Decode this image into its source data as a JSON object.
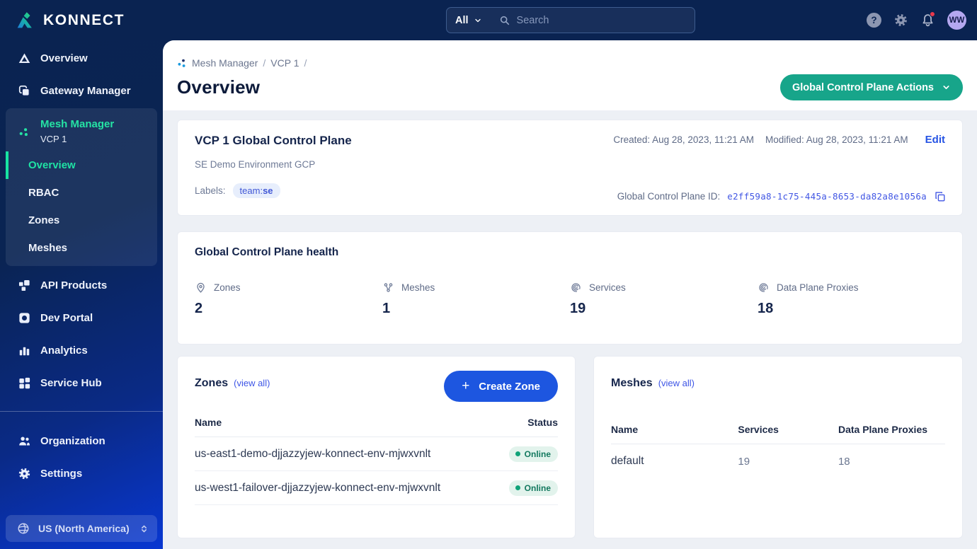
{
  "topbar": {
    "brand": "KONNECT",
    "search_scope": "All",
    "search_placeholder": "Search",
    "help_glyph": "?",
    "avatar_initials": "WW"
  },
  "sidebar": {
    "top_items": [
      {
        "label": "Overview"
      },
      {
        "label": "Gateway Manager"
      }
    ],
    "mesh_panel": {
      "title": "Mesh Manager",
      "subtitle": "VCP 1",
      "sub_items": [
        {
          "label": "Overview",
          "active": true
        },
        {
          "label": "RBAC",
          "active": false
        },
        {
          "label": "Zones",
          "active": false
        },
        {
          "label": "Meshes",
          "active": false
        }
      ]
    },
    "mid_items": [
      {
        "label": "API Products"
      },
      {
        "label": "Dev Portal"
      },
      {
        "label": "Analytics"
      },
      {
        "label": "Service Hub"
      }
    ],
    "bottom_items": [
      {
        "label": "Organization"
      },
      {
        "label": "Settings"
      }
    ],
    "region_selector": "US (North America)"
  },
  "page": {
    "breadcrumb": {
      "product": "Mesh Manager",
      "control_plane": "VCP 1",
      "sep": "/"
    },
    "title": "Overview",
    "actions_button": "Global Control Plane Actions"
  },
  "info_card": {
    "title": "VCP 1 Global Control Plane",
    "description": "SE Demo Environment GCP",
    "labels_label": "Labels:",
    "label_key": "team:",
    "label_value": "se",
    "created": "Created: Aug 28, 2023, 11:21 AM",
    "modified": "Modified: Aug 28, 2023, 11:21 AM",
    "edit_label": "Edit",
    "id_label": "Global Control Plane ID:",
    "id_value": "e2ff59a8-1c75-445a-8653-da82a8e1056a"
  },
  "health_card": {
    "title": "Global Control Plane health",
    "metrics": [
      {
        "label": "Zones",
        "value": "2",
        "icon": "pin-icon"
      },
      {
        "label": "Meshes",
        "value": "1",
        "icon": "mesh-network-icon"
      },
      {
        "label": "Services",
        "value": "19",
        "icon": "service-spiral-icon"
      },
      {
        "label": "Data Plane Proxies",
        "value": "18",
        "icon": "service-spiral-icon"
      }
    ]
  },
  "zones_card": {
    "title": "Zones",
    "view_all": "(view all)",
    "create_button": "Create Zone",
    "plus_glyph": "+",
    "columns": [
      "Name",
      "Status"
    ],
    "rows": [
      {
        "name": "us-east1-demo-djjazzyjew-konnect-env-mjwxvnlt",
        "status": "Online"
      },
      {
        "name": "us-west1-failover-djjazzyjew-konnect-env-mjwxvnlt",
        "status": "Online"
      }
    ]
  },
  "meshes_card": {
    "title": "Meshes",
    "view_all": "(view all)",
    "columns": [
      "Name",
      "Services",
      "Data Plane Proxies"
    ],
    "rows": [
      {
        "name": "default",
        "services": "19",
        "proxies": "18"
      }
    ]
  },
  "colors": {
    "topbar_navy": "#0a2351",
    "sidebar_blue_bottom": "#0837d2",
    "accent_teal_button": "#17a58a",
    "accent_blue_button": "#1d56e0",
    "active_nav_teal": "#1fe2a4",
    "link_blue": "#3d55e6",
    "status_online_green": "#10a379",
    "avatar_purple": "#b4a7f0",
    "notification_red": "#e9394c"
  }
}
